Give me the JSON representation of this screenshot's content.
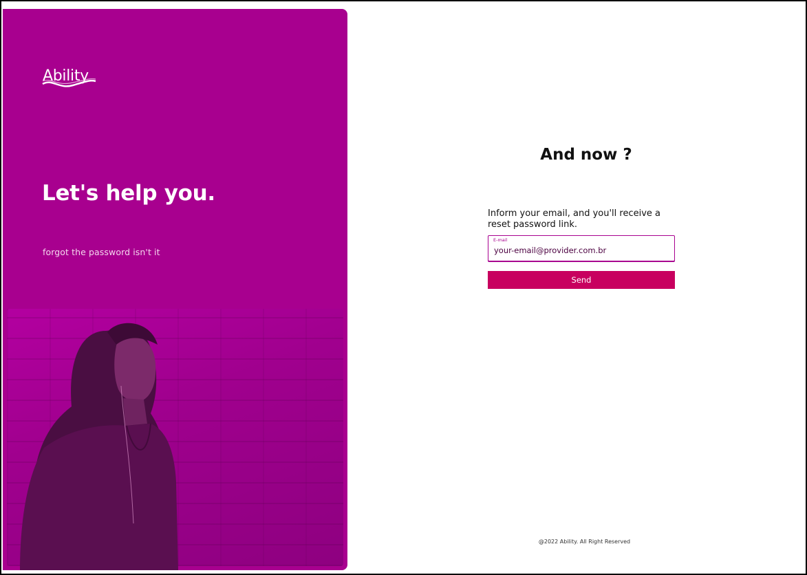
{
  "brand": {
    "logo_text": "Ability",
    "primary_color": "#a8008f",
    "accent_color": "#c8005f"
  },
  "hero": {
    "headline": "Let's help you.",
    "subline": "forgot the password isn't it"
  },
  "form": {
    "title": "And now ?",
    "instructions": "Inform your email, and you'll receive a reset password link.",
    "email_label": "E-mail",
    "email_value": "your-email@provider.com.br",
    "send_label": "Send"
  },
  "footer": {
    "text": "@2022 Ability. All Right Reserved"
  }
}
